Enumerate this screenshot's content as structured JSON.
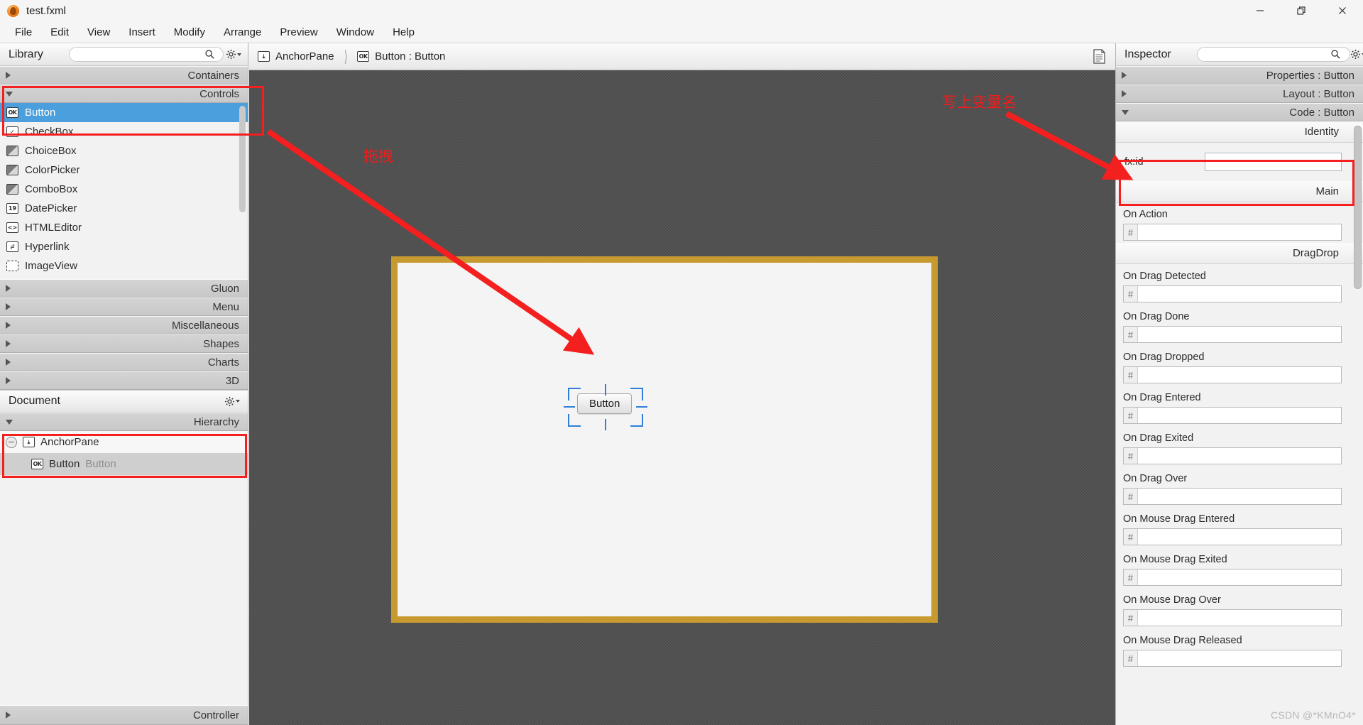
{
  "window": {
    "title": "test.fxml",
    "app_icon": "scenebuilder-icon",
    "controls": [
      {
        "name": "minimize-button",
        "glyph": "minimize-icon"
      },
      {
        "name": "restore-button",
        "glyph": "restore-icon"
      },
      {
        "name": "close-button",
        "glyph": "close-icon"
      }
    ]
  },
  "menubar": {
    "items": [
      "File",
      "Edit",
      "View",
      "Insert",
      "Modify",
      "Arrange",
      "Preview",
      "Window",
      "Help"
    ]
  },
  "library": {
    "title": "Library",
    "search_placeholder": "",
    "search_value": "",
    "search_icon": "search-icon",
    "gear_icon": "gear-icon",
    "sections": [
      {
        "label": "Containers",
        "open": false
      },
      {
        "label": "Controls",
        "open": true
      },
      {
        "label": "Gluon",
        "open": false
      },
      {
        "label": "Menu",
        "open": false
      },
      {
        "label": "Miscellaneous",
        "open": false
      },
      {
        "label": "Shapes",
        "open": false
      },
      {
        "label": "Charts",
        "open": false
      },
      {
        "label": "3D",
        "open": false
      }
    ],
    "items": [
      {
        "label": "Button",
        "icon": "ok",
        "glyph": "OK",
        "selected": true
      },
      {
        "label": "CheckBox",
        "icon": "check",
        "glyph": "✓",
        "selected": false
      },
      {
        "label": "ChoiceBox",
        "icon": "choice",
        "glyph": "▾",
        "selected": false
      },
      {
        "label": "ColorPicker",
        "icon": "color",
        "glyph": "",
        "selected": false
      },
      {
        "label": "ComboBox",
        "icon": "combo",
        "glyph": "▾",
        "selected": false
      },
      {
        "label": "DatePicker",
        "icon": "date",
        "glyph": "19",
        "selected": false
      },
      {
        "label": "HTMLEditor",
        "icon": "html",
        "glyph": "<>",
        "selected": false
      },
      {
        "label": "Hyperlink",
        "icon": "link",
        "glyph": "⚭",
        "selected": false
      },
      {
        "label": "ImageView",
        "icon": "image",
        "glyph": "",
        "selected": false
      }
    ]
  },
  "document": {
    "title": "Document",
    "gear_icon": "gear-icon",
    "hierarchy_label": "Hierarchy",
    "controller_label": "Controller",
    "tree": [
      {
        "name": "AnchorPane",
        "type": "",
        "glyph": "⤓",
        "depth": 0
      },
      {
        "name": "Button",
        "type": "Button",
        "glyph": "OK",
        "depth": 1
      }
    ]
  },
  "content": {
    "breadcrumb": [
      {
        "label": "AnchorPane",
        "glyph": "⤓"
      },
      {
        "label": "Button : Button",
        "glyph": "OK"
      }
    ],
    "doc_icon": "document-icon",
    "canvas_button_label": "Button"
  },
  "inspector": {
    "title": "Inspector",
    "search_placeholder": "",
    "search_value": "",
    "search_icon": "search-icon",
    "gear_icon": "gear-icon",
    "groups": [
      {
        "label": "Properties : Button",
        "open": false
      },
      {
        "label": "Layout : Button",
        "open": false
      },
      {
        "label": "Code : Button",
        "open": true
      }
    ],
    "sections": [
      {
        "label": "Identity"
      },
      {
        "label": "Main"
      },
      {
        "label": "DragDrop"
      }
    ],
    "fxid": {
      "label": "fx:id",
      "value": "",
      "placeholder": ""
    },
    "main_props": [
      {
        "label": "On Action",
        "value": "",
        "prefix": "#"
      }
    ],
    "dragdrop_props": [
      {
        "label": "On Drag Detected",
        "value": "",
        "prefix": "#"
      },
      {
        "label": "On Drag Done",
        "value": "",
        "prefix": "#"
      },
      {
        "label": "On Drag Dropped",
        "value": "",
        "prefix": "#"
      },
      {
        "label": "On Drag Entered",
        "value": "",
        "prefix": "#"
      },
      {
        "label": "On Drag Exited",
        "value": "",
        "prefix": "#"
      },
      {
        "label": "On Drag Over",
        "value": "",
        "prefix": "#"
      },
      {
        "label": "On Mouse Drag Entered",
        "value": "",
        "prefix": "#"
      },
      {
        "label": "On Mouse Drag Exited",
        "value": "",
        "prefix": "#"
      },
      {
        "label": "On Mouse Drag Over",
        "value": "",
        "prefix": "#"
      },
      {
        "label": "On Mouse Drag Released",
        "value": "",
        "prefix": "#"
      }
    ]
  },
  "annotations": {
    "drag_text": "拖拽",
    "fxid_text": "写上变量名",
    "color": "#f41f1f"
  },
  "watermark": "CSDN @*KMnO4*"
}
